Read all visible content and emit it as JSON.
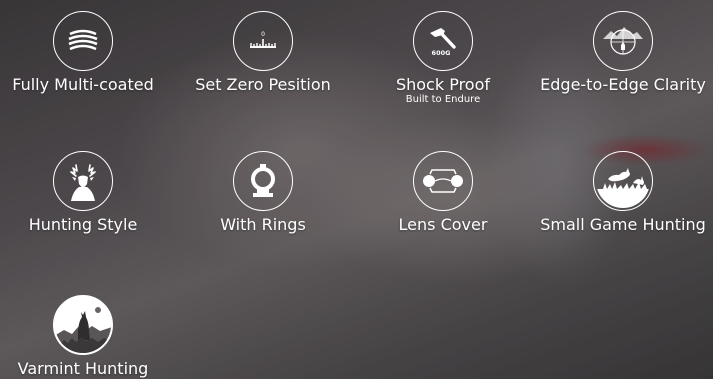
{
  "features": [
    {
      "label": "Fully Multi-coated",
      "icon": "lens-coating-icon"
    },
    {
      "label": "Set Zero Pesition",
      "icon": "zero-scale-icon",
      "scale_mark": "0"
    },
    {
      "label": "Shock Proof",
      "sublabel": "Built to Endure",
      "icon": "hammer-icon",
      "badge_text": "600G"
    },
    {
      "label": "Edge-to-Edge Clarity",
      "icon": "scope-view-icon"
    },
    {
      "label": "Hunting Style",
      "icon": "deer-icon"
    },
    {
      "label": "With Rings",
      "icon": "scope-ring-icon"
    },
    {
      "label": "Lens Cover",
      "icon": "lens-cover-icon"
    },
    {
      "label": "Small Game Hunting",
      "icon": "rabbit-icon"
    },
    {
      "label": "Varmint Hunting",
      "icon": "howling-wolf-icon"
    }
  ],
  "colors": {
    "icon": "#ffffff",
    "text": "#ffffff"
  }
}
